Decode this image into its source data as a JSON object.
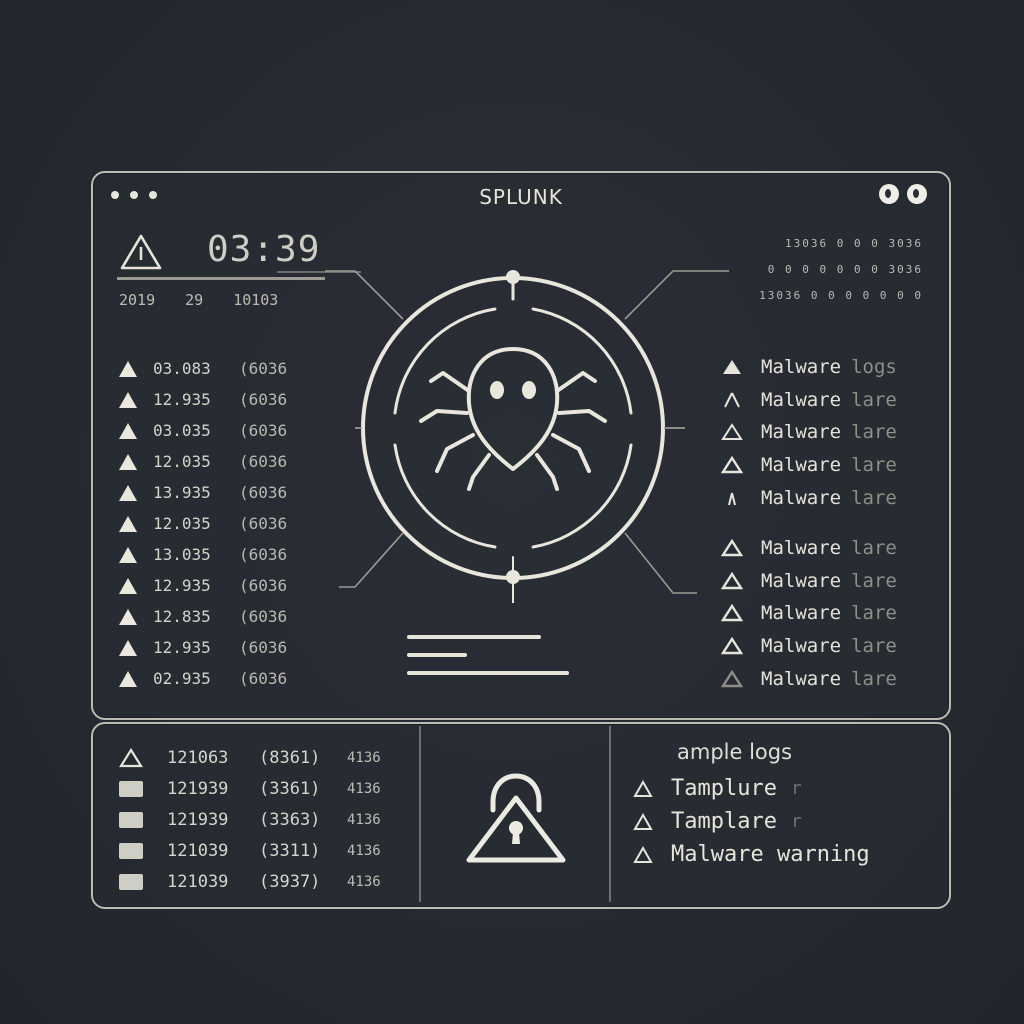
{
  "app": {
    "title": "SPLUNK"
  },
  "header": {
    "time": "03:39",
    "date_parts": [
      "2019",
      "29",
      "10103"
    ]
  },
  "left_logs": [
    {
      "code": "03.083",
      "sub": "(6036"
    },
    {
      "code": "12.935",
      "sub": "(6036"
    },
    {
      "code": "03.035",
      "sub": "(6036"
    },
    {
      "code": "12.035",
      "sub": "(6036"
    },
    {
      "code": "13.935",
      "sub": "(6036"
    },
    {
      "code": "12.035",
      "sub": "(6036"
    },
    {
      "code": "13.035",
      "sub": "(6036"
    },
    {
      "code": "12.935",
      "sub": "(6036"
    },
    {
      "code": "12.835",
      "sub": "(6036"
    },
    {
      "code": "12.935",
      "sub": "(6036"
    },
    {
      "code": "02.935",
      "sub": "(6036"
    }
  ],
  "right_codes": [
    "13036 0 0 0 3036",
    "0 0 0 0 0 0 0 3036",
    "13036 0 0 0 0 0 0 0"
  ],
  "right_logs": [
    {
      "label": "Malware",
      "suffix": "logs"
    },
    {
      "label": "Malware",
      "suffix": "lare"
    },
    {
      "label": "Malware",
      "suffix": "lare"
    },
    {
      "label": "Malware",
      "suffix": "lare"
    },
    {
      "label": "Malware",
      "suffix": "lare"
    },
    {
      "label": "Malware",
      "suffix": "lare"
    },
    {
      "label": "Malware",
      "suffix": "lare"
    },
    {
      "label": "Malware",
      "suffix": "lare"
    },
    {
      "label": "Malware",
      "suffix": "lare"
    },
    {
      "label": "Malware",
      "suffix": "lare"
    }
  ],
  "bottom_logs": [
    {
      "c1": "121063",
      "c2": "(8361)",
      "c3": "4136"
    },
    {
      "c1": "121939",
      "c2": "(3361)",
      "c3": "4136"
    },
    {
      "c1": "121939",
      "c2": "(3363)",
      "c3": "4136"
    },
    {
      "c1": "121039",
      "c2": "(3311)",
      "c3": "4136"
    },
    {
      "c1": "121039",
      "c2": "(3937)",
      "c3": "4136"
    }
  ],
  "templates": {
    "title": "ample logs",
    "items": [
      {
        "label": "Tamplure",
        "faded": "r"
      },
      {
        "label": "Tamplare",
        "faded": "r"
      },
      {
        "label": "Malware warning",
        "faded": ""
      }
    ]
  },
  "colors": {
    "background": "#262a31",
    "stroke": "#e7e5da",
    "panel_border": "#bdbcb1"
  }
}
